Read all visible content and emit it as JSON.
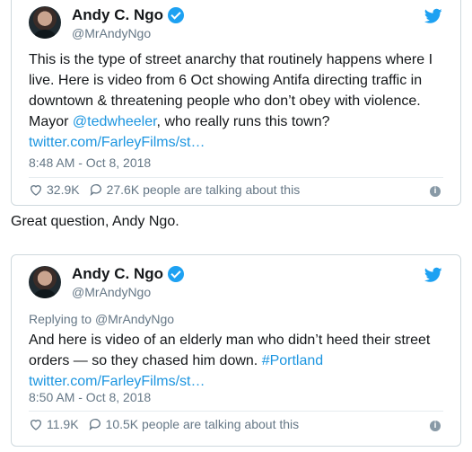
{
  "tweet1": {
    "name": "Andy C. Ngo",
    "handle": "@MrAndyNgo",
    "text_part1": "This is the type of street anarchy that routinely happens where I live. Here is video from 6 Oct showing Antifa directing traffic in downtown & threatening people who don’t obey with violence. Mayor ",
    "mention": "@tedwheeler",
    "text_part2": ", who really runs this town?",
    "link": "twitter.com/FarleyFilms/st…",
    "timestamp": "8:48 AM - Oct 8, 2018",
    "likes": "32.9K",
    "talking": "27.6K people are talking about this"
  },
  "caption": "Great question, Andy Ngo.",
  "tweet2": {
    "name": "Andy C. Ngo",
    "handle": "@MrAndyNgo",
    "reply_prefix": "Replying to ",
    "reply_to": "@MrAndyNgo",
    "text_part1": "And here is video of an elderly man who didn’t heed their street orders — so they chased him down. ",
    "hashtag": "#Portland",
    "link": "twitter.com/FarleyFilms/st…",
    "timestamp": "8:50 AM - Oct 8, 2018",
    "likes": "11.9K",
    "talking": "10.5K people are talking about this"
  },
  "colors": {
    "accent": "#1da1f2",
    "link": "#1b95e0",
    "muted": "#657786"
  },
  "icons": [
    "verified-badge-icon",
    "twitter-bird-icon",
    "heart-icon",
    "comment-icon",
    "info-icon"
  ]
}
